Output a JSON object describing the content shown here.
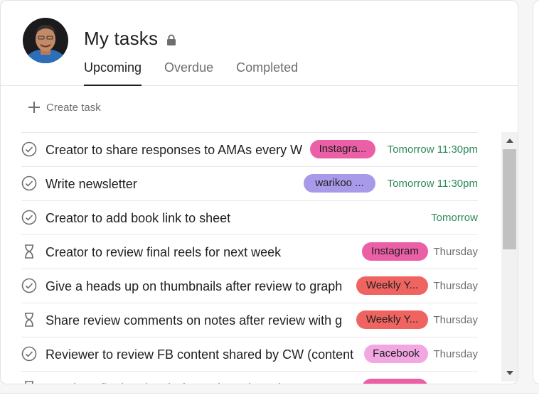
{
  "header": {
    "title": "My tasks",
    "tabs": [
      {
        "label": "Upcoming",
        "active": true
      },
      {
        "label": "Overdue",
        "active": false
      },
      {
        "label": "Completed",
        "active": false
      }
    ]
  },
  "create_task": {
    "label": "Create task"
  },
  "colors": {
    "due_green": "#2d8a5a",
    "due_gray": "#6d6e6f",
    "tag_instagram": "#ea5fa5",
    "tag_warikoo": "#a89ae8",
    "tag_weekly": "#ef6461",
    "tag_facebook": "#f2a7e2"
  },
  "tasks": [
    {
      "status": "check",
      "name": "Creator to share responses to AMAs every W",
      "tag": "Instagra...",
      "tag_color": "#ea5fa5",
      "due": "Tomorrow 11:30pm",
      "due_color": "#2d8a5a"
    },
    {
      "status": "check",
      "name": "Write newsletter",
      "tag": "warikoo ...",
      "tag_color": "#a89ae8",
      "due": "Tomorrow 11:30pm",
      "due_color": "#2d8a5a"
    },
    {
      "status": "check",
      "name": "Creator to add book link to sheet",
      "tag": "",
      "tag_color": "",
      "due": "Tomorrow",
      "due_color": "#2d8a5a"
    },
    {
      "status": "hourglass",
      "name": "Creator to review final reels for next week",
      "tag": "Instagram",
      "tag_color": "#ea5fa5",
      "due": "Thursday",
      "due_color": "#6d6e6f"
    },
    {
      "status": "check",
      "name": "Give a heads up on thumbnails after review to graph",
      "tag": "Weekly Y...",
      "tag_color": "#ef6461",
      "due": "Thursday",
      "due_color": "#6d6e6f"
    },
    {
      "status": "hourglass",
      "name": "Share review comments on notes after review with g",
      "tag": "Weekly Y...",
      "tag_color": "#ef6461",
      "due": "Thursday",
      "due_color": "#6d6e6f"
    },
    {
      "status": "check",
      "name": "Reviewer to review FB content shared by CW (content",
      "tag": "Facebook",
      "tag_color": "#f2a7e2",
      "due": "Thursday",
      "due_color": "#6d6e6f"
    },
    {
      "status": "hourglass",
      "name": "Ready to final review in formation, shared on your to-do",
      "tag": "Instagram",
      "tag_color": "#ea5fa5",
      "due": "Thursday",
      "due_color": "#6d6e6f"
    }
  ]
}
